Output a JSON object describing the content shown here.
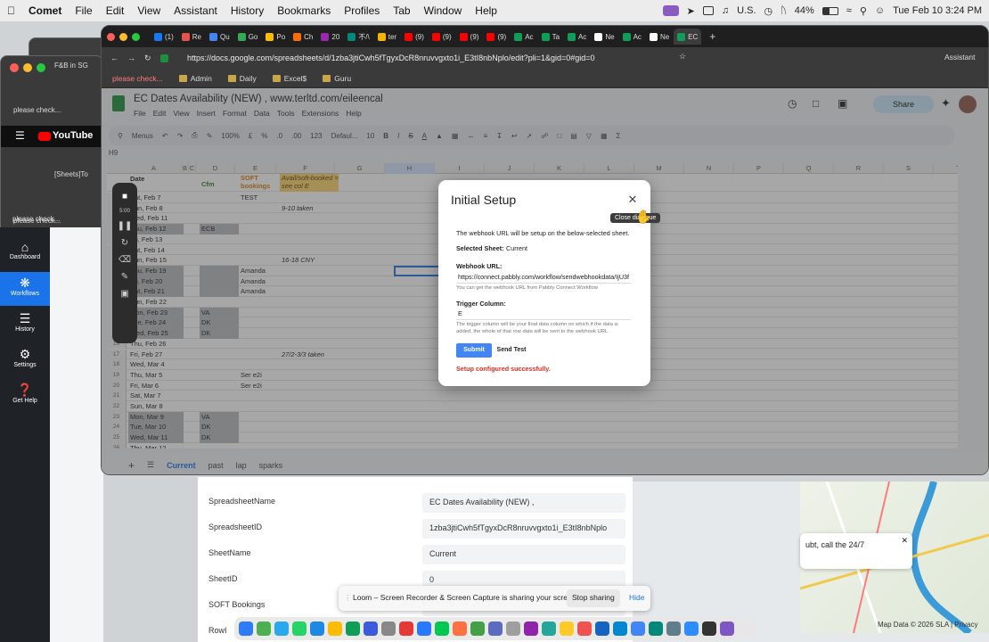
{
  "menubar": {
    "app_name": "Comet",
    "items": [
      "File",
      "Edit",
      "View",
      "Assistant",
      "History",
      "Bookmarks",
      "Profiles",
      "Tab",
      "Window",
      "Help"
    ],
    "input_source": "U.S.",
    "battery": "44%",
    "datetime": "Tue Feb 10  3:24 PM"
  },
  "background_windows": {
    "window_title_1": "F&B in SG",
    "window_title_2": "[Sheets]To",
    "tab_label_1": "please check...",
    "tab_label_2": "please check...",
    "tab_label_3": "please check...",
    "youtube_label": "YouTube"
  },
  "left_app": {
    "nav": [
      {
        "label": "Dashboard",
        "icon": "home-icon"
      },
      {
        "label": "Workflows",
        "icon": "workflow-icon",
        "active": true
      },
      {
        "label": "History",
        "icon": "list-icon"
      },
      {
        "label": "Settings",
        "icon": "gear-icon"
      },
      {
        "label": "Get Help",
        "icon": "help-icon"
      }
    ]
  },
  "browser": {
    "tabs": [
      {
        "label": "(1)"
      },
      {
        "label": "Re"
      },
      {
        "label": "Qu"
      },
      {
        "label": "Go"
      },
      {
        "label": "Po"
      },
      {
        "label": "Ch"
      },
      {
        "label": "20"
      },
      {
        "label": "不/\\"
      },
      {
        "label": "ter"
      },
      {
        "label": "(9)"
      },
      {
        "label": "(9)"
      },
      {
        "label": "(9)"
      },
      {
        "label": "(9)"
      },
      {
        "label": "Ac"
      },
      {
        "label": "Ta"
      },
      {
        "label": "Ac"
      },
      {
        "label": "Ne"
      },
      {
        "label": "Ac"
      },
      {
        "label": "Ne"
      },
      {
        "label": "EC",
        "active": true
      }
    ],
    "url": "https://docs.google.com/spreadsheets/d/1zba3jtiCwh5fTgyxDcR8nruvvgxto1i_E3tI8nbNplo/edit?pli=1&gid=0#gid=0",
    "assistant_label": "Assistant",
    "bookmarks": [
      "please check...",
      "Admin",
      "Daily",
      "Excel$",
      "Guru"
    ]
  },
  "sheet": {
    "title": "EC Dates Availability (NEW) , www.terltd.com/eileencal",
    "menu": [
      "File",
      "Edit",
      "View",
      "Insert",
      "Format",
      "Data",
      "Tools",
      "Extensions",
      "Help"
    ],
    "share_label": "Share",
    "toolbar": {
      "menus": "Menus",
      "zoom": "100%",
      "currency": "£",
      "percent": "%",
      "dec1": ".0",
      "dec2": ".00",
      "fmt": "123",
      "font": "Defaul...",
      "size": "10"
    },
    "cell_ref": "H9",
    "columns": [
      "A",
      "B",
      "C",
      "D",
      "E",
      "F",
      "G",
      "H",
      "I",
      "J",
      "K",
      "L",
      "M",
      "N",
      "P",
      "Q",
      "R",
      "S",
      "T"
    ],
    "header_row": {
      "col_a": "Date",
      "col_d": "Cfm",
      "col_e": "SOFT bookings",
      "col_f": "Avail/soft-booked = see col E"
    },
    "rows": [
      {
        "n": "2",
        "a": "Sat, Feb 7",
        "d": "",
        "e": "TEST",
        "f": "",
        "shade": false
      },
      {
        "n": "3",
        "a": "Sun, Feb 8",
        "d": "",
        "e": "",
        "f": "9-10 taken",
        "shade": false
      },
      {
        "n": "4",
        "a": "Wed, Feb 11",
        "d": "",
        "e": "",
        "f": "",
        "shade": false
      },
      {
        "n": "5",
        "a": "Thu, Feb 12",
        "d": "ECB",
        "e": "",
        "f": "",
        "shade": true
      },
      {
        "n": "6",
        "a": "Fri, Feb 13",
        "d": "",
        "e": "",
        "f": "",
        "shade": false
      },
      {
        "n": "7",
        "a": "Sat, Feb 14",
        "d": "",
        "e": "",
        "f": "",
        "shade": false
      },
      {
        "n": "8",
        "a": "Sun, Feb 15",
        "d": "",
        "e": "",
        "f": "16-18 CNY",
        "shade": false
      },
      {
        "n": "9",
        "a": "Thu, Feb 19",
        "d": "",
        "e": "Amanda",
        "f": "",
        "shade": true
      },
      {
        "n": "10",
        "a": "Fri, Feb 20",
        "d": "",
        "e": "Amanda",
        "f": "",
        "shade": true
      },
      {
        "n": "11",
        "a": "Sat, Feb 21",
        "d": "",
        "e": "Amanda",
        "f": "",
        "shade": true
      },
      {
        "n": "12",
        "a": "Sun, Feb 22",
        "d": "",
        "e": "",
        "f": "",
        "shade": false
      },
      {
        "n": "13",
        "a": "Mon, Feb 23",
        "d": "VA",
        "e": "",
        "f": "",
        "shade": true
      },
      {
        "n": "14",
        "a": "Tue, Feb 24",
        "d": "DK",
        "e": "",
        "f": "",
        "shade": true
      },
      {
        "n": "15",
        "a": "Wed, Feb 25",
        "d": "DK",
        "e": "",
        "f": "",
        "shade": true
      },
      {
        "n": "16",
        "a": "Thu, Feb 26",
        "d": "",
        "e": "",
        "f": "",
        "shade": false
      },
      {
        "n": "17",
        "a": "Fri, Feb 27",
        "d": "",
        "e": "",
        "f": "27/2-3/3 taken",
        "shade": false
      },
      {
        "n": "18",
        "a": "Wed, Mar 4",
        "d": "",
        "e": "",
        "f": "",
        "shade": false
      },
      {
        "n": "19",
        "a": "Thu, Mar 5",
        "d": "",
        "e": "Ser e2i",
        "f": "",
        "shade": false
      },
      {
        "n": "20",
        "a": "Fri, Mar 6",
        "d": "",
        "e": "Ser e2i",
        "f": "",
        "shade": false
      },
      {
        "n": "21",
        "a": "Sat, Mar 7",
        "d": "",
        "e": "",
        "f": "",
        "shade": false
      },
      {
        "n": "22",
        "a": "Sun, Mar 8",
        "d": "",
        "e": "",
        "f": "",
        "shade": false
      },
      {
        "n": "23",
        "a": "Mon, Mar 9",
        "d": "VA",
        "e": "",
        "f": "",
        "shade": true
      },
      {
        "n": "24",
        "a": "Tue, Mar 10",
        "d": "DK",
        "e": "",
        "f": "",
        "shade": true
      },
      {
        "n": "25",
        "a": "Wed, Mar 11",
        "d": "DK",
        "e": "",
        "f": "",
        "shade": true
      },
      {
        "n": "26",
        "a": "Thu, Mar 12",
        "d": "",
        "e": "",
        "f": "",
        "shade": false
      }
    ],
    "tabs": [
      "Current",
      "past",
      "lap",
      "sparks"
    ]
  },
  "recorder": {
    "timer": "5:00"
  },
  "modal": {
    "title": "Initial Setup",
    "close_tooltip": "Close dialogue",
    "intro": "The webhook URL will be setup on the below-selected sheet.",
    "selected_sheet_label": "Selected Sheet:",
    "selected_sheet_value": "Current",
    "webhook_label": "Webhook URL:",
    "webhook_value": "https://connect.pabbly.com/workflow/sendwebhookdata/IjU3f",
    "webhook_help": "You can get the webhook URL from Pabbly Connect Workflow",
    "trigger_label": "Trigger Column:",
    "trigger_value": "E",
    "trigger_help": "The trigger column will be your final data column on which if the data is added, the whole of that row data will be sent to the webhook URL",
    "submit_label": "Submit",
    "send_test_label": "Send Test",
    "status": "Setup configured successfully."
  },
  "form": {
    "rows": [
      {
        "label": "SpreadsheetName",
        "value": "EC Dates Availability (NEW) ,"
      },
      {
        "label": "SpreadsheetID",
        "value": "1zba3jtiCwh5fTgyxDcR8nruvvgxto1i_E3tI8nbNplo"
      },
      {
        "label": "SheetName",
        "value": "Current"
      },
      {
        "label": "SheetID",
        "value": "0"
      },
      {
        "label": "SOFT Bookings",
        "value": ""
      },
      {
        "label": "RowI",
        "value": ""
      }
    ]
  },
  "loom": {
    "message": "Loom – Screen Recorder & Screen Capture is sharing your screen.",
    "stop_label": "Stop sharing",
    "hide_label": "Hide"
  },
  "notification": {
    "text": "ubt, call the 24/7"
  },
  "map": {
    "data_label": "Map Data © 2026 SLA | Privacy"
  }
}
